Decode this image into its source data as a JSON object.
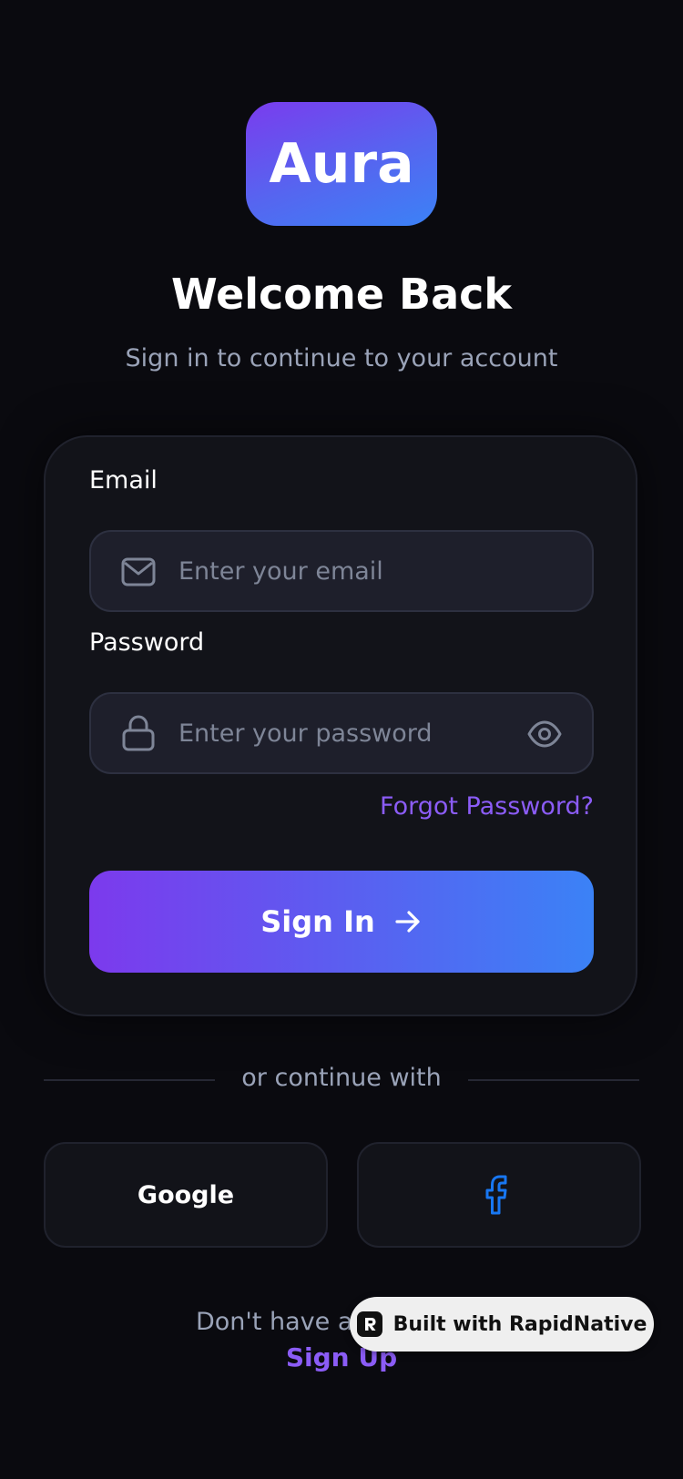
{
  "app": {
    "logo_text": "Aura"
  },
  "header": {
    "title": "Welcome Back",
    "subtitle": "Sign in to continue to your account"
  },
  "form": {
    "email": {
      "label": "Email",
      "placeholder": "Enter your email",
      "icon": "mail-icon"
    },
    "password": {
      "label": "Password",
      "placeholder": "Enter your password",
      "icon": "lock-icon",
      "toggle_icon": "eye-icon"
    },
    "forgot_label": "Forgot Password?",
    "submit_label": "Sign In"
  },
  "divider": {
    "text": "or continue with"
  },
  "social": {
    "google_label": "Google",
    "facebook_icon": "facebook-icon"
  },
  "footer": {
    "prompt": "Don't have an account?",
    "signup_label": "Sign Up"
  },
  "badge": {
    "label": "Built with RapidNative"
  },
  "colors": {
    "background": "#0a0a0f",
    "card": "#121319",
    "accent_purple": "#8b5cf6",
    "gradient_start": "#7c3aed",
    "gradient_end": "#3b82f6",
    "facebook_blue": "#1877f2"
  }
}
